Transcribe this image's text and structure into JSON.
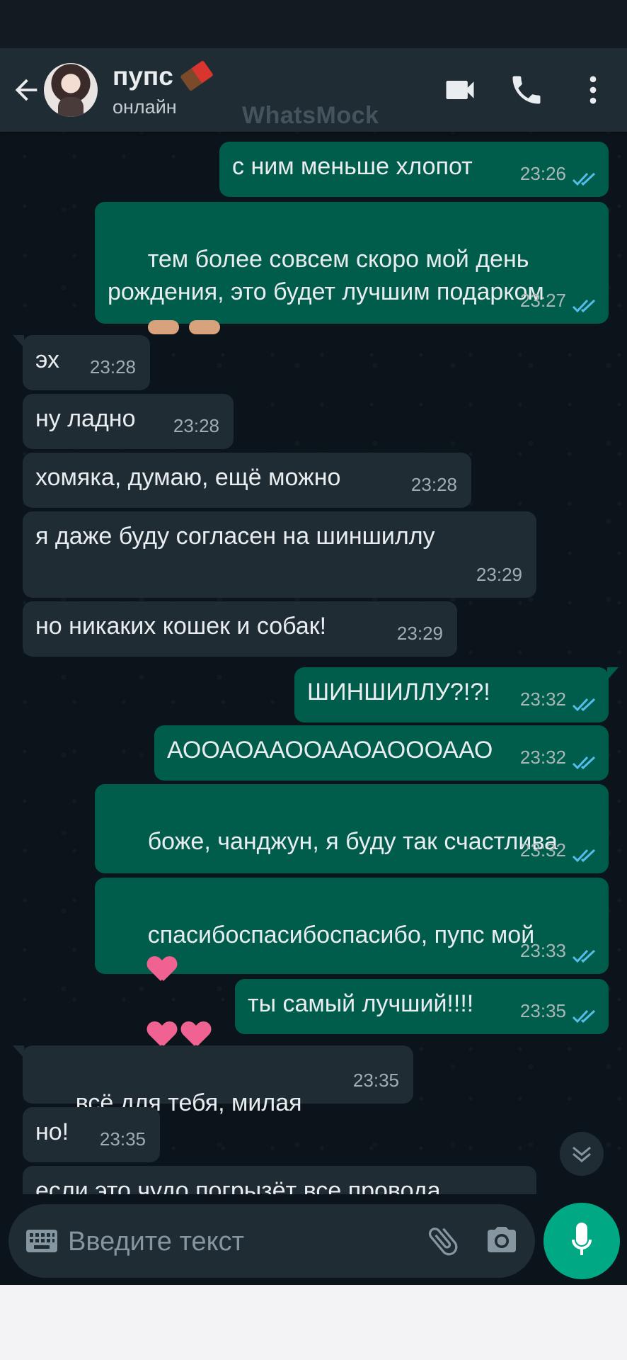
{
  "header": {
    "contact_name": "пупс",
    "contact_status": "онлайн",
    "watermark": "WhatsMock"
  },
  "messages": [
    {
      "dir": "out",
      "text": "с ним меньше хлопот",
      "time": "23:26",
      "read": true
    },
    {
      "dir": "out",
      "text": "тем более совсем скоро мой день рождения, это будет лучшим подарком",
      "time": "23:27",
      "read": true
    },
    {
      "dir": "in",
      "text": "эх",
      "time": "23:28"
    },
    {
      "dir": "in",
      "text": "ну ладно",
      "time": "23:28"
    },
    {
      "dir": "in",
      "text": "хомяка, думаю, ещё можно",
      "time": "23:28"
    },
    {
      "dir": "in",
      "text": "я даже буду согласен на шиншиллу",
      "time": "23:29"
    },
    {
      "dir": "in",
      "text": "но никаких кошек и собак!",
      "time": "23:29"
    },
    {
      "dir": "out",
      "text": "ШИНШИЛЛУ?!?!",
      "time": "23:32",
      "read": true
    },
    {
      "dir": "out",
      "text": "АООАОААООААОАОООААО",
      "time": "23:32",
      "read": true
    },
    {
      "dir": "out",
      "text": "боже, чанджун, я буду так счастлива",
      "time": "23:32",
      "read": true
    },
    {
      "dir": "out",
      "text": "спасибоспасибоспасибо, пупс мой",
      "time": "23:33",
      "read": true
    },
    {
      "dir": "out",
      "text": "ты самый лучший!!!!",
      "time": "23:35",
      "read": true
    },
    {
      "dir": "in",
      "text": "всё для тебя, милая",
      "time": "23:35"
    },
    {
      "dir": "in",
      "text": "но!",
      "time": "23:35"
    },
    {
      "dir": "in",
      "text": "если это чудо погрызёт все провода",
      "time": ""
    }
  ],
  "input": {
    "placeholder": "Введите текст"
  },
  "colors": {
    "chat_bg": "#0b141a",
    "header_bg": "#1f2c34",
    "outgoing_bubble": "#005c4b",
    "incoming_bubble": "#1f2c34",
    "read_ticks": "#53bdeb",
    "accent": "#00a884"
  },
  "icons": [
    "back-arrow-icon",
    "chocolate-emoji",
    "video-call-icon",
    "phone-icon",
    "more-options-icon",
    "keyboard-icon",
    "paperclip-icon",
    "camera-icon",
    "mic-icon",
    "chevron-down-icon"
  ]
}
